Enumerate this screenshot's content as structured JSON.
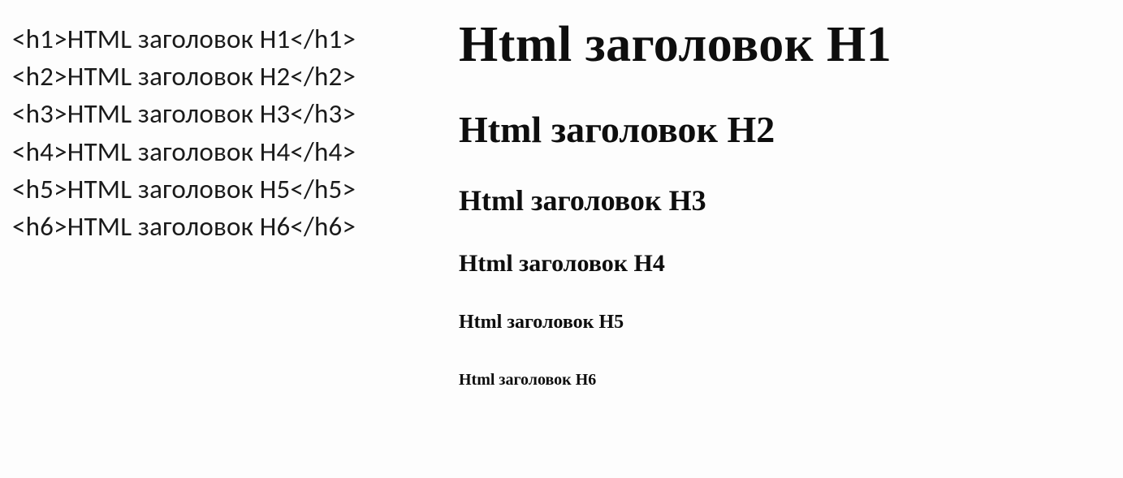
{
  "code": {
    "lines": [
      "<h1>HTML заголовок H1</h1>",
      "<h2>HTML заголовок H2</h2>",
      "<h3>HTML заголовок H3</h3>",
      "<h4>HTML заголовок H4</h4>",
      "<h5>HTML заголовок H5</h5>",
      "<h6>HTML заголовок H6</h6>"
    ]
  },
  "rendered": {
    "h1": "Html заголовок H1",
    "h2": "Html заголовок H2",
    "h3": "Html заголовок H3",
    "h4": "Html заголовок H4",
    "h5": "Html заголовок H5",
    "h6": "Html заголовок H6"
  }
}
